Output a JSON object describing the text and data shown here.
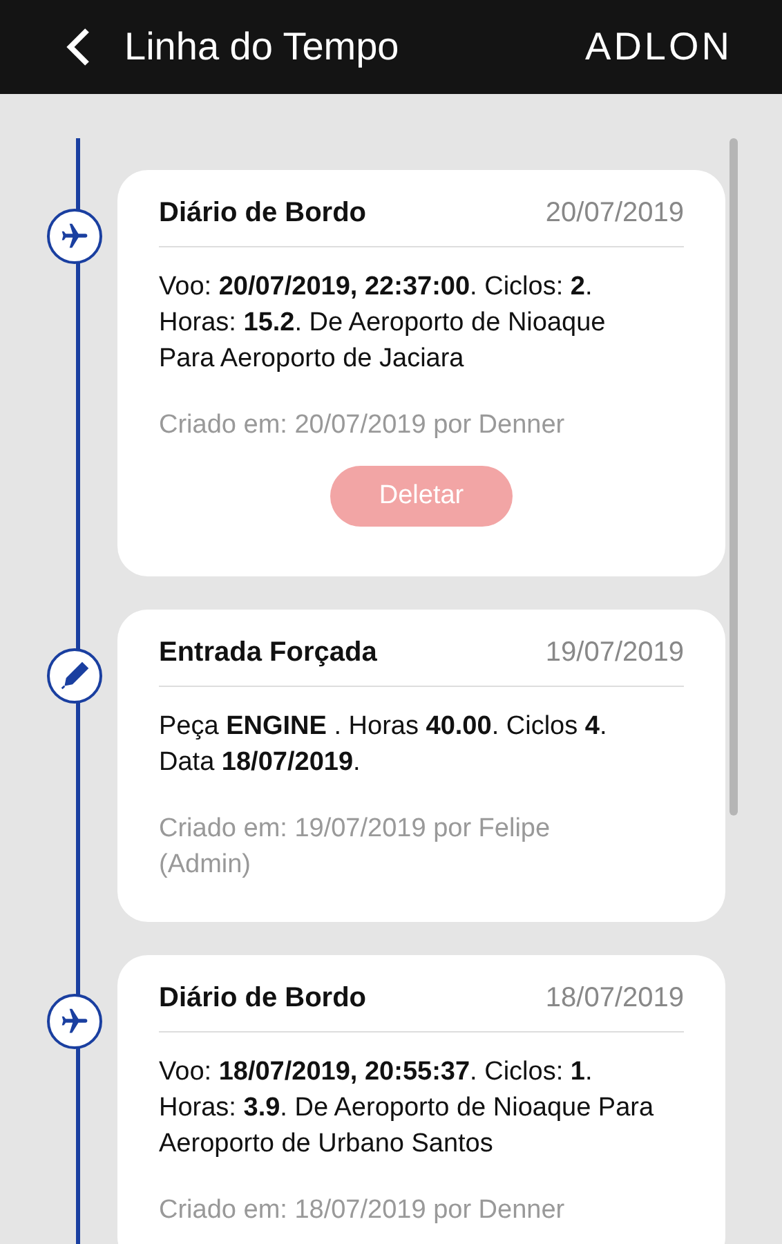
{
  "header": {
    "title": "Linha do Tempo",
    "brand": "ADLON"
  },
  "entries": [
    {
      "kind": "flight",
      "title": "Diário de Bordo",
      "date": "20/07/2019",
      "body": "Voo: **20/07/2019, 22:37:00**. Ciclos: **2**. Horas: **15.2**. De Aeroporto de Nioaque Para Aeroporto de Jaciara",
      "created": "Criado em: 20/07/2019 por Denner",
      "delete_button": "Deletar"
    },
    {
      "kind": "manual",
      "title": "Entrada Forçada",
      "date": "19/07/2019",
      "body": "Peça **ENGINE** . Horas **40.00**. Ciclos **4**. Data **18/07/2019**.",
      "created": "Criado em: 19/07/2019 por Felipe (Admin)"
    },
    {
      "kind": "flight",
      "title": "Diário de Bordo",
      "date": "18/07/2019",
      "body": "Voo: **18/07/2019, 20:55:37**. Ciclos: **1**. Horas: **3.9**. De Aeroporto de Nioaque Para Aeroporto de Urbano Santos",
      "created": "Criado em: 18/07/2019 por Denner"
    }
  ]
}
